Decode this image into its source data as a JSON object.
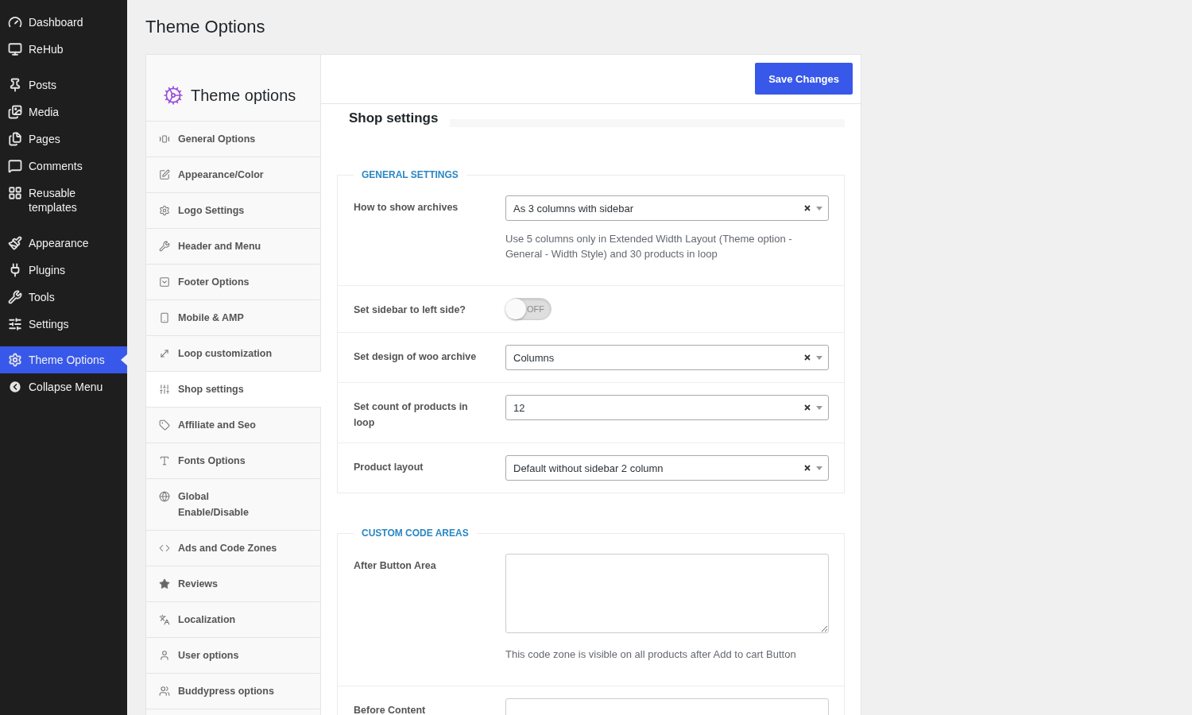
{
  "admin_menu": {
    "groups": [
      [
        {
          "label": "Dashboard",
          "selected": false
        },
        {
          "label": "ReHub",
          "selected": false
        }
      ],
      [
        {
          "label": "Posts",
          "selected": false
        },
        {
          "label": "Media",
          "selected": false
        },
        {
          "label": "Pages",
          "selected": false
        },
        {
          "label": "Comments",
          "selected": false
        },
        {
          "label": "Reusable templates",
          "selected": false
        }
      ],
      [
        {
          "label": "Appearance",
          "selected": false
        },
        {
          "label": "Plugins",
          "selected": false
        },
        {
          "label": "Tools",
          "selected": false
        },
        {
          "label": "Settings",
          "selected": false
        }
      ],
      [
        {
          "label": "Theme Options",
          "selected": true
        }
      ]
    ],
    "collapse": "Collapse Menu"
  },
  "page_title": "Theme Options",
  "options_panel": {
    "title": "Theme options",
    "nav": [
      {
        "label": "General Options",
        "selected": false
      },
      {
        "label": "Appearance/Color",
        "selected": false
      },
      {
        "label": "Logo Settings",
        "selected": false
      },
      {
        "label": "Header and Menu",
        "selected": false
      },
      {
        "label": "Footer Options",
        "selected": false
      },
      {
        "label": "Mobile & AMP",
        "selected": false
      },
      {
        "label": "Loop customization",
        "selected": false
      },
      {
        "label": "Shop settings",
        "selected": true
      },
      {
        "label": "Affiliate and Seo",
        "selected": false
      },
      {
        "label": "Fonts Options",
        "selected": false
      },
      {
        "label": "Global\nEnable/Disable",
        "selected": false
      },
      {
        "label": "Ads and Code Zones",
        "selected": false
      },
      {
        "label": "Reviews",
        "selected": false
      },
      {
        "label": "Localization",
        "selected": false
      },
      {
        "label": "User options",
        "selected": false
      },
      {
        "label": "Buddypress options",
        "selected": false
      }
    ],
    "save_button": "Save Changes",
    "section_title": "Shop settings",
    "fieldsets": [
      {
        "legend": "GENERAL SETTINGS",
        "fields": [
          {
            "kind": "select",
            "label": "How to show archives",
            "value": "As 3 columns with sidebar",
            "description": "Use 5 columns only in Extended Width Layout (Theme option - General - Width Style) and 30 products in loop"
          },
          {
            "kind": "toggle",
            "label": "Set sidebar to left side?",
            "on": false,
            "state_label": "OFF"
          },
          {
            "kind": "select",
            "label": "Set design of woo archive",
            "value": "Columns"
          },
          {
            "kind": "select",
            "label": "Set count of products in loop",
            "value": "12"
          },
          {
            "kind": "select",
            "label": "Product layout",
            "value": "Default without sidebar 2 column"
          }
        ]
      },
      {
        "legend": "CUSTOM CODE AREAS",
        "fields": [
          {
            "kind": "textarea",
            "label": "After Button Area",
            "description": "This code zone is visible on all products after Add to cart Button"
          },
          {
            "kind": "textarea",
            "label": "Before Content"
          }
        ]
      }
    ]
  }
}
